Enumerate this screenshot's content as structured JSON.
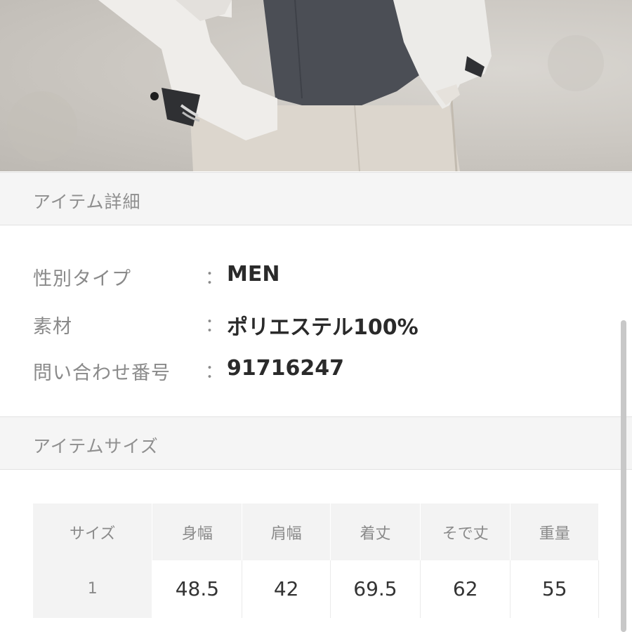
{
  "hero": {
    "image": "product-photo-jacket"
  },
  "item_details": {
    "header": "アイテム詳細",
    "rows": [
      {
        "label": "性別タイプ",
        "colon": "：",
        "value": "MEN"
      },
      {
        "label": "素材",
        "colon": "：",
        "value": "ポリエステル100%"
      },
      {
        "label": "問い合わせ番号",
        "colon": "：",
        "value": "91716247"
      }
    ]
  },
  "item_size": {
    "header": "アイテムサイズ",
    "columns": [
      "サイズ",
      "身幅",
      "肩幅",
      "着丈",
      "そで丈",
      "重量"
    ],
    "rows": [
      [
        "1",
        "48.5",
        "42",
        "69.5",
        "62",
        "55"
      ]
    ]
  },
  "colors": {
    "header_bg": "#f5f5f5",
    "label": "#8a8a8a",
    "value": "#2a2a2a"
  }
}
